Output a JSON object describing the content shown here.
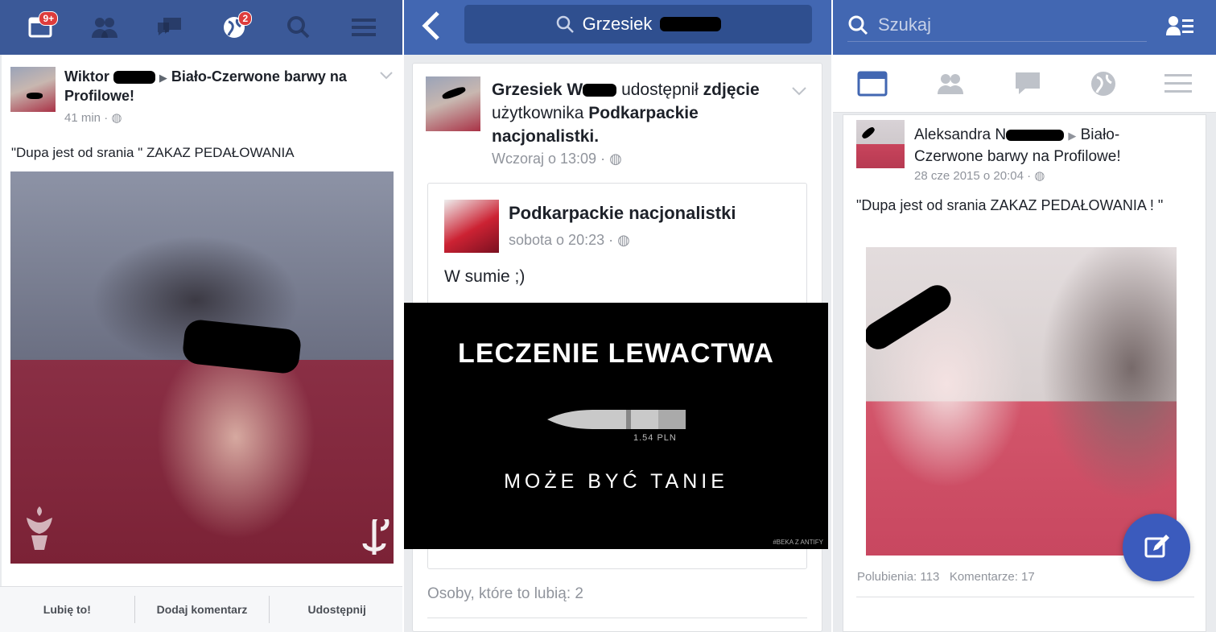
{
  "panel1": {
    "notification_badge": "9+",
    "globe_badge": "2",
    "post": {
      "author": "Wiktor",
      "target": "Biało-Czerwone barwy na Profilowe!",
      "time": "41 min",
      "text": "\"Dupa jest od srania \" ZAKAZ PEDAŁOWANIA"
    },
    "actions": {
      "like": "Lubię to!",
      "comment": "Dodaj komentarz",
      "share": "Udostępnij"
    }
  },
  "panel2": {
    "search_value": "Grzesiek",
    "post": {
      "author": "Grzesiek W",
      "action_text": "udostępnił",
      "bold_word": "zdjęcie",
      "user_text": "użytkownika",
      "page_name": "Podkarpackie nacjonalistki.",
      "time": "Wczoraj o 13:09"
    },
    "shared": {
      "page_name": "Podkarpackie nacjonalistki",
      "time": "sobota o 20:23",
      "text": "W sumie ;)"
    },
    "meme": {
      "title": "LECZENIE LEWACTWA",
      "price": "1.54 PLN",
      "subtitle": "MOŻE BYĆ TANIE",
      "watermark": "#BEKA Z ANTIFY"
    },
    "likes_text": "Osoby, które to lubią: 2"
  },
  "panel3": {
    "search_placeholder": "Szukaj",
    "post": {
      "author": "Aleksandra N",
      "target": "Biało-Czerwone barwy na Profilowe!",
      "time": "28 cze 2015 o 20:04",
      "text": "\"Dupa jest od srania ZAKAZ PEDAŁOWANIA ! \""
    },
    "stats": {
      "likes": "Polubienia: 113",
      "comments": "Komentarze: 17"
    }
  },
  "colors": {
    "facebook_blue": "#3b5998",
    "header_blue": "#4267b2",
    "badge_red": "#dd3c3c"
  }
}
